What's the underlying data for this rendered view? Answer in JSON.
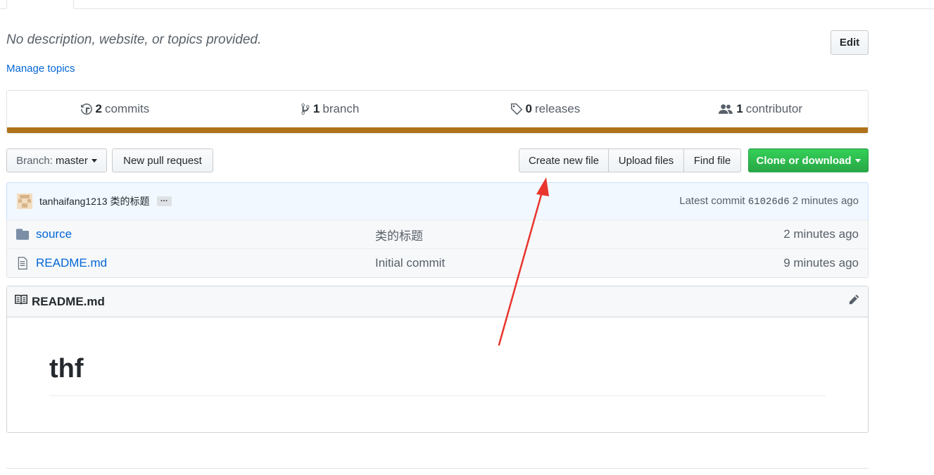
{
  "repo": {
    "description": "No description, website, or topics provided.",
    "manage_topics": "Manage topics",
    "edit_label": "Edit"
  },
  "summary": {
    "commits_count": "2",
    "commits_label": "commits",
    "branch_count": "1",
    "branch_label": "branch",
    "releases_count": "0",
    "releases_label": "releases",
    "contributors_count": "1",
    "contributors_label": "contributor",
    "language_color": "#b07219"
  },
  "toolbar": {
    "branch_prefix": "Branch:",
    "branch_name": "master",
    "new_pr": "New pull request",
    "create_file": "Create new file",
    "upload_files": "Upload files",
    "find_file": "Find file",
    "clone": "Clone or download"
  },
  "commit": {
    "author": "tanhaifang1213",
    "message": "类的标题",
    "ellipsis": "…",
    "latest_label": "Latest commit",
    "sha": "61026d6",
    "age": "2 minutes ago"
  },
  "files": [
    {
      "icon": "folder-icon",
      "name": "source",
      "message": "类的标题",
      "age": "2 minutes ago"
    },
    {
      "icon": "file-icon",
      "name": "README.md",
      "message": "Initial commit",
      "age": "9 minutes ago"
    }
  ],
  "readme": {
    "title": "README.md",
    "heading": "thf"
  },
  "colors": {
    "link": "#0366d6",
    "clone_green": "#28a745",
    "annotation_arrow": "#e8352d"
  }
}
